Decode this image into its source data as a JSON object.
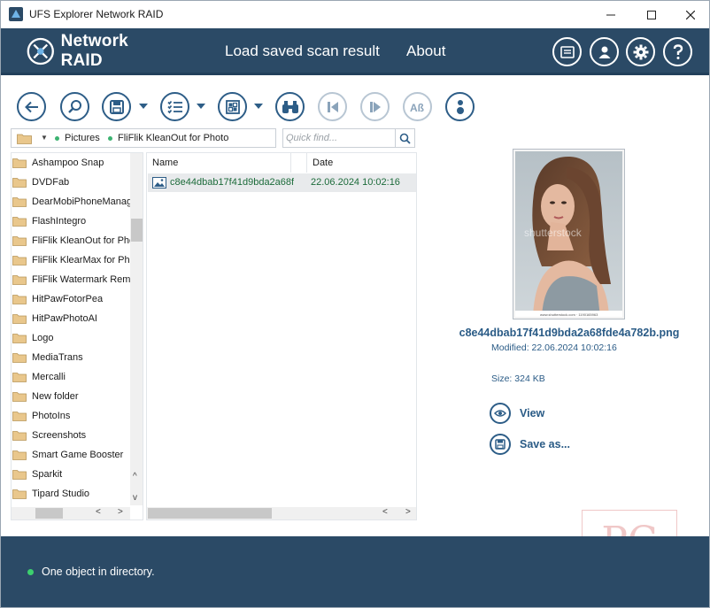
{
  "window": {
    "title": "UFS Explorer Network RAID"
  },
  "header": {
    "logo_text": "Network RAID",
    "nav": {
      "load": "Load saved scan result",
      "about": "About"
    },
    "buttons": [
      "news-icon",
      "user-icon",
      "gear-icon",
      "help-icon"
    ]
  },
  "toolbar": {
    "buttons": [
      "back-icon",
      "search-icon",
      "save-icon",
      "list-view-icon",
      "thumbnail-view-icon",
      "binoculars-icon",
      "prev-icon",
      "next-icon",
      "case-icon",
      "info-icon"
    ]
  },
  "path": {
    "crumbs": [
      "Pictures",
      "FliFlik KleanOut for Photo"
    ],
    "search_placeholder": "Quick find..."
  },
  "tree": {
    "items": [
      "Ashampoo Snap",
      "DVDFab",
      "DearMobiPhoneManager",
      "FlashIntegro",
      "FliFlik KleanOut for Photo",
      "FliFlik KlearMax for Photo",
      "FliFlik Watermark Remover",
      "HitPawFotorPea",
      "HitPawPhotoAI",
      "Logo",
      "MediaTrans",
      "Mercalli",
      "New folder",
      "PhotoIns",
      "Screenshots",
      "Smart Game Booster",
      "Sparkit",
      "Tipard Studio"
    ]
  },
  "files": {
    "columns": {
      "name": "Name",
      "date": "Date"
    },
    "rows": [
      {
        "name": "c8e44dbab17f41d9bda2a68fde4a782b.png",
        "date": "22.06.2024 10:02:16"
      }
    ]
  },
  "preview": {
    "filename": "c8e44dbab17f41d9bda2a68fde4a782b.png",
    "modified": "Modified: 22.06.2024 10:02:16",
    "size": "Size: 324 KB",
    "view_label": "View",
    "save_label": "Save as...",
    "image_watermark": "shutterstock",
    "image_caption": "www.shutterstock.com · 1190165963"
  },
  "status": {
    "text": "One object in directory."
  },
  "watermark": {
    "text": "PC"
  },
  "colors": {
    "accent": "#2b4a66",
    "link": "#2a5b86",
    "file_text": "#1c6b3a",
    "status_dot": "#3cd06e"
  }
}
